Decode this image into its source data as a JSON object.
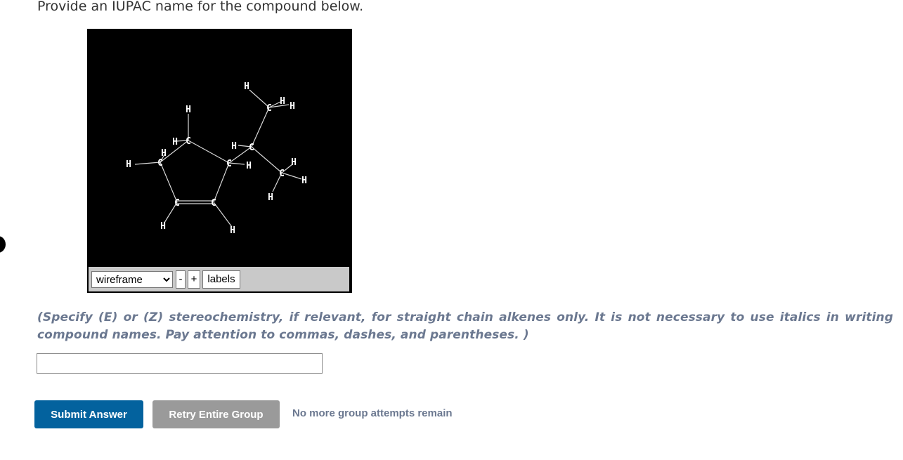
{
  "question": {
    "prompt": "Provide an IUPAC name for the compound below."
  },
  "viewer": {
    "atoms": {
      "c1": "C",
      "c2": "C",
      "c3": "C",
      "c4": "C",
      "c5": "C",
      "c6": "C",
      "c7": "C",
      "c8": "C",
      "h1": "H",
      "h2": "H",
      "h3": "H",
      "h4": "H",
      "h5": "H",
      "h6": "H",
      "h7": "H",
      "h8": "H",
      "h9": "H",
      "h10": "H",
      "h11": "H",
      "h12": "H",
      "h13": "H",
      "h14": "H"
    },
    "render_mode": {
      "selected": "wireframe"
    },
    "zoom_out_label": "-",
    "zoom_in_label": "+",
    "labels_label": "labels"
  },
  "instructions": "(Specify (E) or (Z) stereochemistry, if relevant, for straight chain alkenes only. It is not necessary to use italics in writing compound names. Pay attention to commas, dashes, and parentheses. )",
  "answer_field": {
    "value": "",
    "placeholder": ""
  },
  "buttons": {
    "submit_label": "Submit Answer",
    "retry_label": "Retry Entire Group"
  },
  "status": "No more group attempts remain",
  "colors": {
    "primary": "#03629e",
    "muted_button": "#9a9a9a",
    "instruction_text": "#6b7890"
  }
}
